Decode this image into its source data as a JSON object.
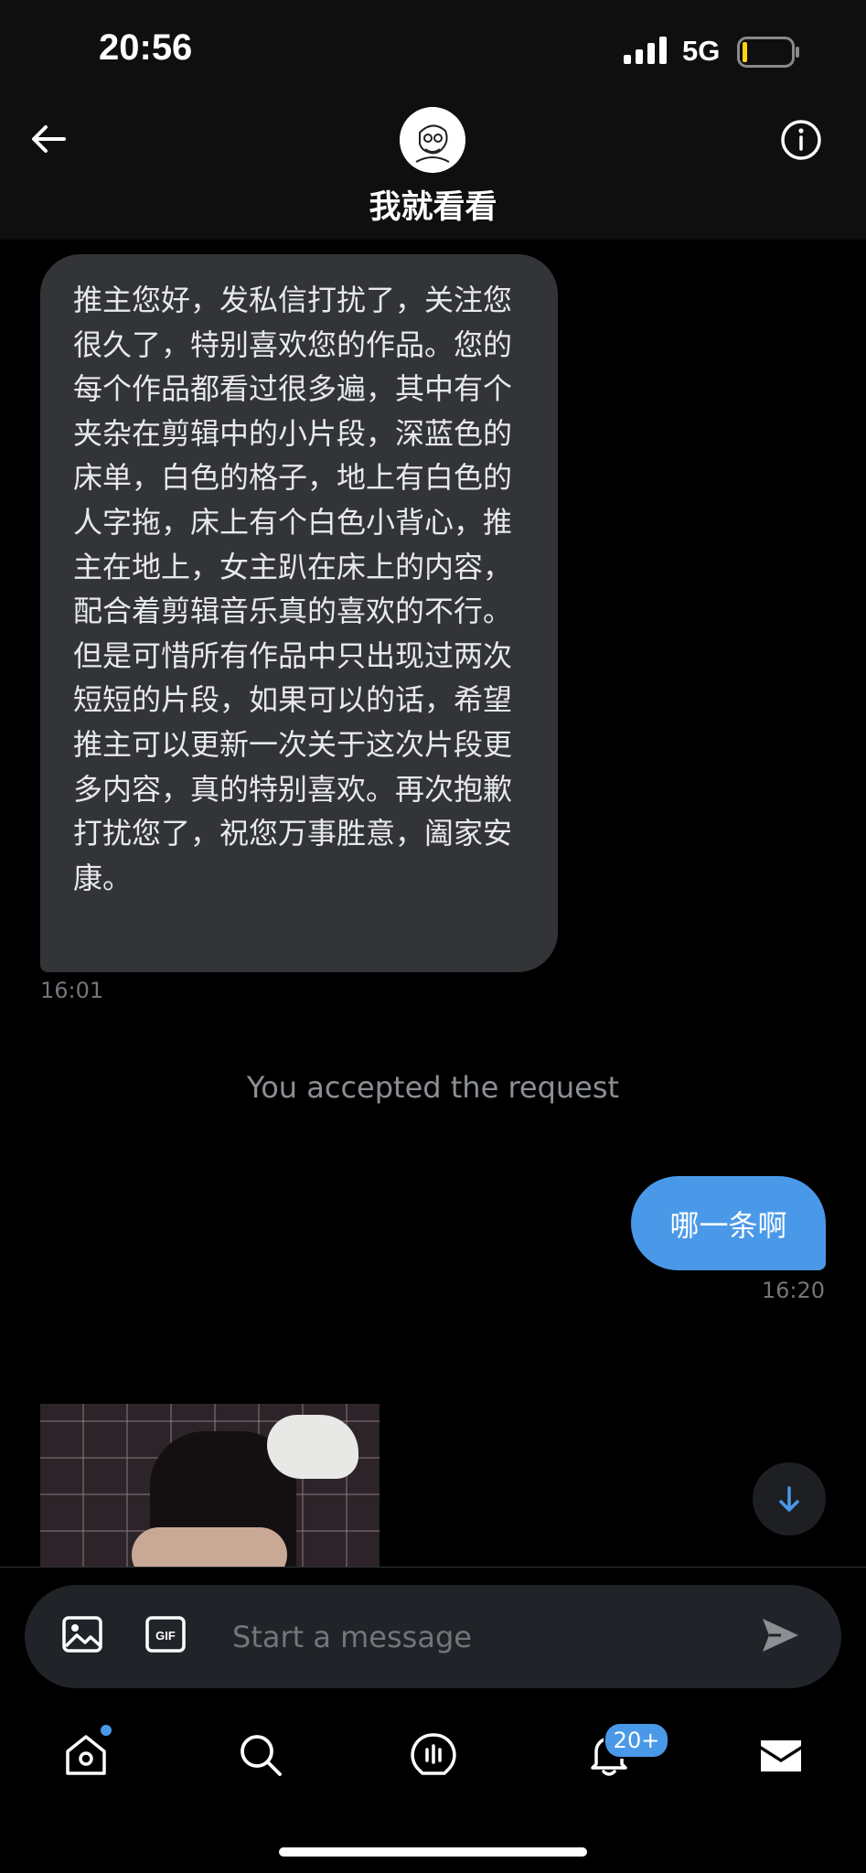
{
  "status_bar": {
    "time": "20:56",
    "network": "5G",
    "battery_level": 0.1
  },
  "header": {
    "title": "我就看看",
    "avatar_icon": "user-avatar-sketch",
    "back_icon": "arrow-left-icon",
    "info_icon": "info-icon"
  },
  "messages": [
    {
      "direction": "incoming",
      "text": "推主您好，发私信打扰了，关注您很久了，特别喜欢您的作品。您的每个作品都看过很多遍，其中有个夹杂在剪辑中的小片段，深蓝色的床单，白色的格子，地上有白色的人字拖，床上有个白色小背心，推主在地上，女主趴在床上的内容，配合着剪辑音乐真的喜欢的不行。但是可惜所有作品中只出现过两次短短的片段，如果可以的话，希望推主可以更新一次关于这次片段更多内容，真的特别喜欢。再次抱歉打扰您了，祝您万事胜意，阖家安康。",
      "time": "16:01"
    },
    {
      "direction": "system",
      "text": "You accepted the request"
    },
    {
      "direction": "outgoing",
      "text": "哪一条啊",
      "time": "16:20"
    },
    {
      "direction": "incoming",
      "type": "media"
    }
  ],
  "composer": {
    "placeholder": "Start a message",
    "gif_label": "GIF"
  },
  "nav": {
    "items": [
      "home",
      "search",
      "spaces",
      "notifications",
      "messages"
    ],
    "notifications_badge": "20+"
  },
  "colors": {
    "accent": "#4a99e9",
    "incoming_bubble": "#333438",
    "background": "#000000"
  }
}
